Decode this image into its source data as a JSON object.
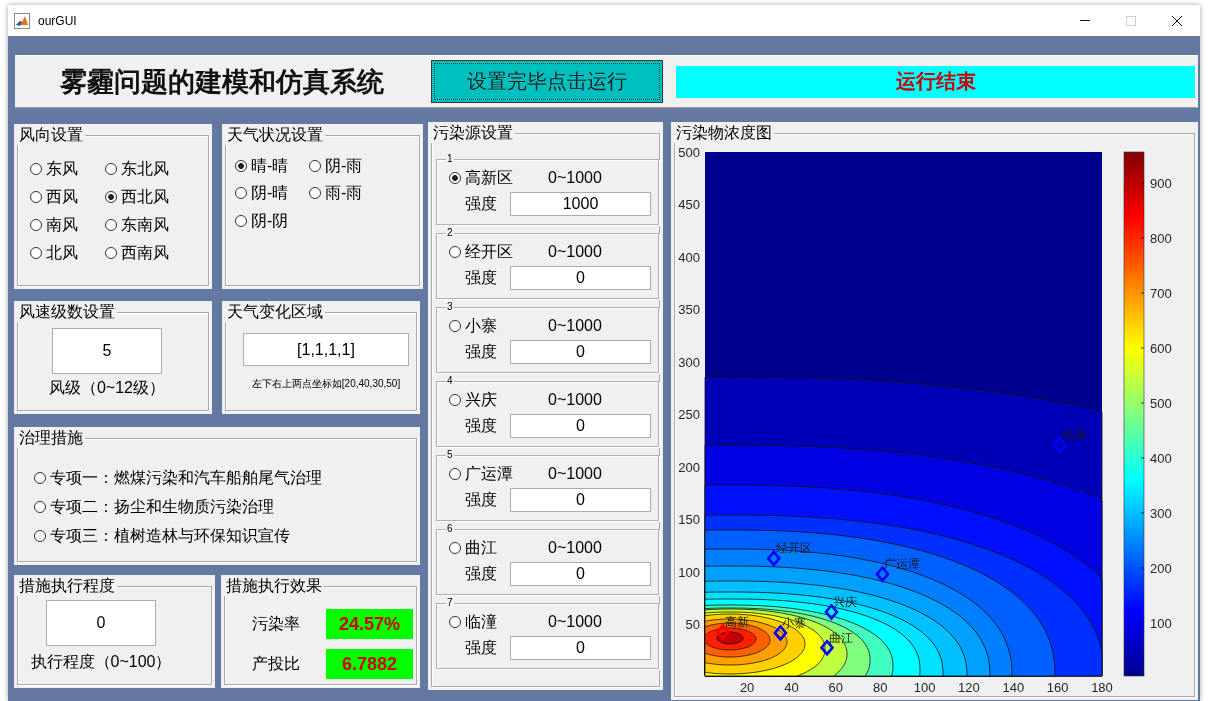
{
  "window": {
    "title": "ourGUI",
    "maximize_enabled": false
  },
  "header": {
    "title": "雾霾问题的建模和仿真系统",
    "run_button": "设置完毕点击运行",
    "status": "运行结束"
  },
  "wind_direction": {
    "title": "风向设置",
    "options": [
      {
        "label": "东风",
        "selected": false
      },
      {
        "label": "东北风",
        "selected": false
      },
      {
        "label": "西风",
        "selected": false
      },
      {
        "label": "西北风",
        "selected": true
      },
      {
        "label": "南风",
        "selected": false
      },
      {
        "label": "东南风",
        "selected": false
      },
      {
        "label": "北风",
        "selected": false
      },
      {
        "label": "西南风",
        "selected": false
      }
    ]
  },
  "weather": {
    "title": "天气状况设置",
    "options": [
      {
        "label": "晴-晴",
        "selected": true
      },
      {
        "label": "阴-雨",
        "selected": false
      },
      {
        "label": "阴-晴",
        "selected": false
      },
      {
        "label": "雨-雨",
        "selected": false
      },
      {
        "label": "阴-阴",
        "selected": false
      }
    ]
  },
  "wind_speed": {
    "title": "风速级数设置",
    "value": "5",
    "caption": "风级（0~12级）"
  },
  "weather_region": {
    "title": "天气变化区域",
    "value": "[1,1,1,1]",
    "hint": "左下右上两点坐标如[20,40,30,50]"
  },
  "measures": {
    "title": "治理措施",
    "options": [
      {
        "label": "专项一：燃煤污染和汽车船舶尾气治理",
        "selected": false
      },
      {
        "label": "专项二：扬尘和生物质污染治理",
        "selected": false
      },
      {
        "label": "专项三：植树造林与环保知识宣传",
        "selected": false
      }
    ]
  },
  "execution": {
    "title": "措施执行程度",
    "value": "0",
    "caption": "执行程度（0~100）"
  },
  "effect": {
    "title": "措施执行效果",
    "rows": [
      {
        "label": "污染率",
        "value": "24.57%"
      },
      {
        "label": "产投比",
        "value": "6.7882"
      }
    ]
  },
  "sources": {
    "title": "污染源设置",
    "items": [
      {
        "number": "1",
        "name": "高新区",
        "selected": true,
        "range": "0~1000",
        "strength_label": "强度",
        "strength": "1000"
      },
      {
        "number": "2",
        "name": "经开区",
        "selected": false,
        "range": "0~1000",
        "strength_label": "强度",
        "strength": "0"
      },
      {
        "number": "3",
        "name": "小寨",
        "selected": false,
        "range": "0~1000",
        "strength_label": "强度",
        "strength": "0"
      },
      {
        "number": "4",
        "name": "兴庆",
        "selected": false,
        "range": "0~1000",
        "strength_label": "强度",
        "strength": "0"
      },
      {
        "number": "5",
        "name": "广运潭",
        "selected": false,
        "range": "0~1000",
        "strength_label": "强度",
        "strength": "0"
      },
      {
        "number": "6",
        "name": "曲江",
        "selected": false,
        "range": "0~1000",
        "strength_label": "强度",
        "strength": "0"
      },
      {
        "number": "7",
        "name": "临潼",
        "selected": false,
        "range": "0~1000",
        "strength_label": "强度",
        "strength": "0"
      }
    ]
  },
  "plot": {
    "title": "污染物浓度图",
    "chart_data": {
      "type": "scatter",
      "x": [
        9,
        32,
        35,
        58,
        81,
        56,
        161
      ],
      "series": [
        {
          "color": "#ff0000",
          "values": [
            43,
            null,
            null,
            null,
            null,
            null,
            null
          ]
        },
        {
          "color": "#0000ff",
          "values": [
            null,
            113,
            42,
            62,
            98,
            28,
            221
          ]
        }
      ],
      "xlim": [
        1,
        180
      ],
      "ylim": [
        1,
        500
      ],
      "xticks": [
        20,
        40,
        60,
        80,
        100,
        120,
        140,
        160,
        180
      ],
      "yticks": [
        50,
        100,
        150,
        200,
        250,
        300,
        350,
        400,
        450,
        500
      ],
      "annotations": [
        {
          "x": 9,
          "y": 43,
          "text": "高新"
        },
        {
          "x": 32,
          "y": 113,
          "text": "经开区"
        },
        {
          "x": 35,
          "y": 42,
          "text": "小寨"
        },
        {
          "x": 58,
          "y": 62,
          "text": "兴庆"
        },
        {
          "x": 81,
          "y": 98,
          "text": "广运潭"
        },
        {
          "x": 56,
          "y": 28,
          "text": "曲江"
        },
        {
          "x": 161,
          "y": 221,
          "text": "临潼"
        }
      ]
    },
    "colorbar": {
      "ticks": [
        "900",
        "800",
        "700",
        "600",
        "500",
        "400",
        "300",
        "200",
        "100"
      ]
    }
  }
}
